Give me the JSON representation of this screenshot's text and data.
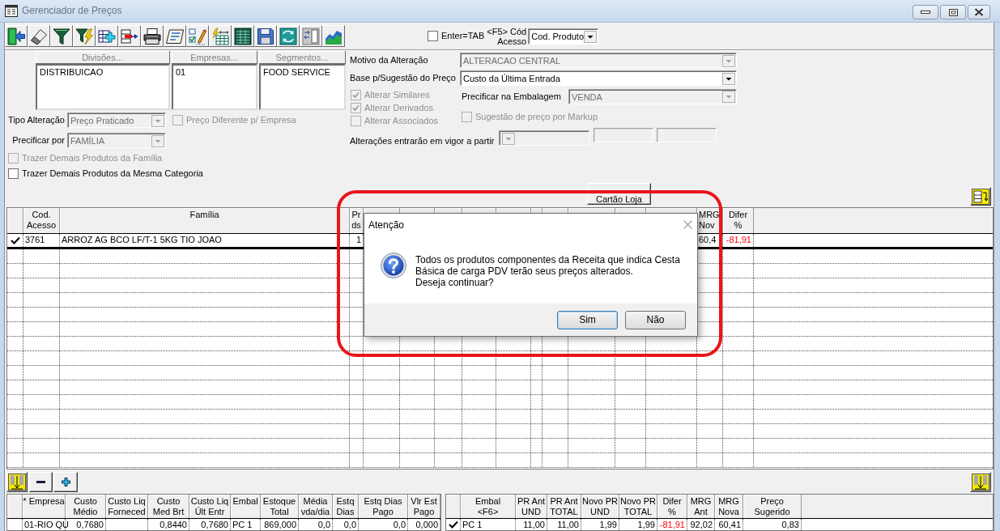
{
  "window": {
    "title": "Gerenciador de Preços"
  },
  "toolbar": {
    "enter_tab": {
      "label": "Enter=TAB",
      "checked": false
    },
    "access_code": {
      "label": "<F5> Cód\nAcesso",
      "value": "Cod. Produto"
    }
  },
  "filters": {
    "lists": [
      {
        "header": "Divisões...",
        "disabled": true,
        "items": [
          "DISTRIBUICAO"
        ]
      },
      {
        "header": "Empresas...",
        "disabled": true,
        "items": [
          "01"
        ]
      },
      {
        "header": "Segmentos...",
        "disabled": true,
        "items": [
          "FOOD SERVICE"
        ]
      }
    ],
    "tipo_alteracao": {
      "label": "Tipo Alteração",
      "value": "Preço Praticado",
      "disabled": true
    },
    "preco_diferente": {
      "label": "Preço Diferente p/ Empresa",
      "checked": false,
      "disabled": true
    },
    "precificar_por": {
      "label": "Precificar por",
      "value": "FAMÍLIA",
      "disabled": true
    },
    "trazer": [
      {
        "label": "Trazer Demais Produtos da Família",
        "checked": false,
        "disabled": true
      },
      {
        "label": "Trazer Demais Produtos da Mesma Categoria",
        "checked": false,
        "disabled": false
      }
    ],
    "motivo": {
      "label": "Motivo da Alteração",
      "value": "ALTERACAO CENTRAL",
      "disabled": true
    },
    "base": {
      "label": "Base p/Sugestão do Preço",
      "value": "Custo da Última Entrada",
      "disabled": false
    },
    "alterar": [
      {
        "label": "Alterar Similares",
        "checked": true,
        "disabled": true
      },
      {
        "label": "Alterar Derivados",
        "checked": true,
        "disabled": true
      },
      {
        "label": "Alterar Associados",
        "checked": false,
        "disabled": true
      }
    ],
    "embalagem": {
      "label": "Precificar na Embalagem",
      "value": "VENDA",
      "disabled": true
    },
    "markup": {
      "label": "Sugestão de preço por Markup",
      "checked": false,
      "disabled": true
    },
    "vigor": {
      "label": "Alterações entrarão em vigor a partir",
      "disabled": true
    }
  },
  "cartao_loja": {
    "label": "Cartão Loja"
  },
  "main_grid": {
    "columns": [
      "Cod.\nAcesso",
      "Família",
      "Pr\nds",
      "MRG\nNov",
      "Difer\n%"
    ],
    "rows": [
      {
        "selected": true,
        "cells": [
          {
            "text": "3761",
            "negative": false
          },
          {
            "text": "ARROZ AG BCO LF/T-1 5KG TIO JOAO",
            "negative": false
          },
          {
            "text": "1",
            "negative": false
          },
          {
            "text": "60,4",
            "negative": false
          },
          {
            "text": "-81,91",
            "negative": true
          }
        ]
      }
    ]
  },
  "stock_grid": {
    "columns": [
      "* Empresa",
      "Custo\nMédio",
      "Custo Liq\nForneced",
      "Custo\nMed Brt",
      "Custo Liq\nÚlt Entr",
      "Embal",
      "Estoque\nTotal",
      "Média\nvda/dia",
      "Estq\nDias",
      "Estq Dias\nPago",
      "Vlr Est\nPago"
    ],
    "rows": [
      {
        "selected": false,
        "cells": [
          {
            "text": "01-RIO QU",
            "negative": false
          },
          {
            "text": "0,7680",
            "negative": false
          },
          null,
          {
            "text": "0,8440",
            "negative": false
          },
          {
            "text": "0,7680",
            "negative": false
          },
          {
            "text": "PC 1",
            "negative": false
          },
          {
            "text": "869,000",
            "negative": false
          },
          {
            "text": "0,0",
            "negative": false
          },
          {
            "text": "0,0",
            "negative": false
          },
          {
            "text": "0,0",
            "negative": false
          },
          {
            "text": "0,000",
            "negative": false
          }
        ]
      }
    ]
  },
  "price_grid": {
    "columns": [
      "Embal\n<F6>",
      "PR Ant\nUND",
      "PR Ant\nTOTAL",
      "Novo PR\nUND",
      "Novo PR\nTOTAL",
      "Difer\n%",
      "MRG\nAnt",
      "MRG\nNova",
      "Preço\nSugerido"
    ],
    "rows": [
      {
        "selected": true,
        "cells": [
          {
            "text": "PC 1",
            "negative": false
          },
          {
            "text": "11,00",
            "negative": false
          },
          {
            "text": "11,00",
            "negative": false
          },
          {
            "text": "1,99",
            "negative": false
          },
          {
            "text": "1,99",
            "negative": false
          },
          {
            "text": "-81,91",
            "negative": true
          },
          {
            "text": "92,02",
            "negative": false
          },
          {
            "text": "60,41",
            "negative": false
          },
          {
            "text": "0,83",
            "negative": false
          }
        ]
      }
    ]
  },
  "dialog": {
    "title": "Atenção",
    "message": "Todos os produtos componentes da Receita que indica Cesta\nBásica de carga PDV terão seus preços alterados.\nDeseja continuar?",
    "buttons": [
      {
        "label": "Sim",
        "focused": true
      },
      {
        "label": "Não",
        "focused": false
      }
    ]
  }
}
